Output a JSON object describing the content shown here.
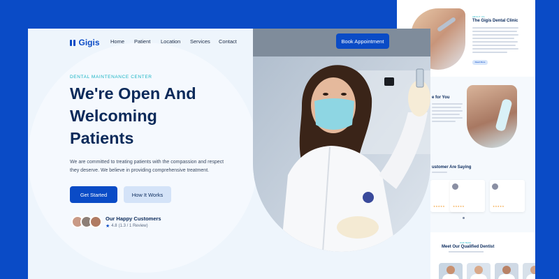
{
  "brand": {
    "name": "Gigis"
  },
  "nav": {
    "items": [
      "Home",
      "Patient",
      "Location",
      "Services",
      "Contact"
    ],
    "cta": "Book Appointment"
  },
  "hero": {
    "kicker": "DENTAL MAINTENANCE CENTER",
    "headline": [
      "We're Open And",
      "Welcoming",
      "Patients"
    ],
    "paragraph": [
      "We are committed to treating patients with the compassion and respect",
      "they deserve. We believe in providing comprehensive treatment."
    ],
    "primary_button": "Get Started",
    "secondary_button": "How It Works"
  },
  "customers": {
    "title": "Our Happy Customers",
    "rating": "4.8",
    "reviews": "(1.3 / 1 Review)"
  },
  "back_page": {
    "about_kicker": "ABOUT US",
    "about_title": "The Gigis Dental Clinic",
    "read_more": "Read More",
    "section_care": "e for You",
    "section_testimonials": "ustomer Are Saying",
    "section_team_kicker": "OUR TEAM",
    "section_team": "Meet Our Qualified Dentist",
    "stars": "★★★★★"
  },
  "colors": {
    "accent": "#0a4bc6",
    "teal": "#19b4c4",
    "heading": "#0b2a5a",
    "background": "#0a4bc6"
  }
}
